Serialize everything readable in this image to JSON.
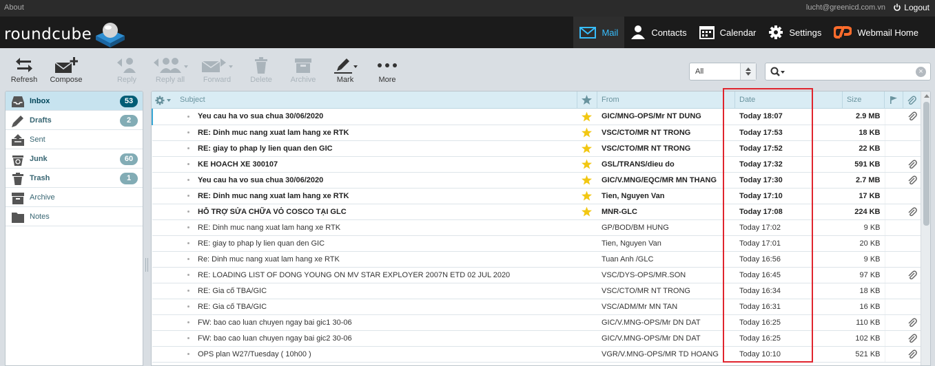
{
  "topbar": {
    "about": "About",
    "user_email": "lucht@greenicd.com.vn",
    "logout": "Logout"
  },
  "logo": {
    "text": "roundcube"
  },
  "nav": [
    {
      "label": "Mail",
      "icon": "mail-icon",
      "active": true
    },
    {
      "label": "Contacts",
      "icon": "contacts-icon"
    },
    {
      "label": "Calendar",
      "icon": "calendar-icon"
    },
    {
      "label": "Settings",
      "icon": "gear-icon"
    },
    {
      "label": "Webmail Home",
      "icon": "cpanel-icon"
    }
  ],
  "toolbar": {
    "refresh": "Refresh",
    "compose": "Compose",
    "reply": "Reply",
    "reply_all": "Reply all",
    "forward": "Forward",
    "delete": "Delete",
    "archive": "Archive",
    "mark": "Mark",
    "more": "More"
  },
  "filter": {
    "selected": "All"
  },
  "search": {
    "value": ""
  },
  "folders": [
    {
      "name": "Inbox",
      "count": "53",
      "selected": true,
      "bold": true
    },
    {
      "name": "Drafts",
      "count": "2",
      "bold": true
    },
    {
      "name": "Sent",
      "count": ""
    },
    {
      "name": "Junk",
      "count": "60",
      "bold": true
    },
    {
      "name": "Trash",
      "count": "1",
      "bold": true
    },
    {
      "name": "Archive",
      "count": ""
    },
    {
      "name": "Notes",
      "count": ""
    }
  ],
  "list_header": {
    "subject": "Subject",
    "from": "From",
    "date": "Date",
    "size": "Size"
  },
  "messages": [
    {
      "subject": "Yeu cau ha vo sua chua 30/06/2020",
      "from": "GIC/MNG-OPS/Mr NT DUNG",
      "date": "Today 18:07",
      "size": "2.9 MB",
      "unread": true,
      "flagged": true,
      "attachment": true
    },
    {
      "subject": "RE: Dinh muc nang xuat lam hang xe RTK",
      "from": "VSC/CTO/MR NT TRONG",
      "date": "Today 17:53",
      "size": "18 KB",
      "unread": true,
      "flagged": true,
      "attachment": false
    },
    {
      "subject": "RE: giay to phap ly lien quan den GIC",
      "from": "VSC/CTO/MR NT TRONG",
      "date": "Today 17:52",
      "size": "22 KB",
      "unread": true,
      "flagged": true,
      "attachment": false
    },
    {
      "subject": "KE HOACH XE 300107",
      "from": "GSL/TRANS/dieu do",
      "date": "Today 17:32",
      "size": "591 KB",
      "unread": true,
      "flagged": true,
      "attachment": true
    },
    {
      "subject": "Yeu cau ha vo sua chua 30/06/2020",
      "from": "GIC/V.MNG/EQC/MR MN THANG",
      "date": "Today 17:30",
      "size": "2.7 MB",
      "unread": true,
      "flagged": true,
      "attachment": true
    },
    {
      "subject": "RE: Dinh muc nang xuat lam hang xe RTK",
      "from": "Tien, Nguyen Van",
      "date": "Today 17:10",
      "size": "17 KB",
      "unread": true,
      "flagged": true,
      "attachment": false
    },
    {
      "subject": "HỖ TRỢ SỬA CHỮA VỎ COSCO TẠI GLC",
      "from": "MNR-GLC",
      "date": "Today 17:08",
      "size": "224 KB",
      "unread": true,
      "flagged": true,
      "attachment": true
    },
    {
      "subject": "RE: Dinh muc nang xuat lam hang xe RTK",
      "from": "GP/BOD/BM HUNG",
      "date": "Today 17:02",
      "size": "9 KB",
      "unread": false,
      "flagged": false,
      "attachment": false
    },
    {
      "subject": "RE: giay to phap ly lien quan den GIC",
      "from": "Tien, Nguyen Van",
      "date": "Today 17:01",
      "size": "20 KB",
      "unread": false,
      "flagged": false,
      "attachment": false
    },
    {
      "subject": "Re: Dinh muc nang xuat lam hang xe RTK",
      "from": "Tuan Anh /GLC",
      "date": "Today 16:56",
      "size": "9 KB",
      "unread": false,
      "flagged": false,
      "attachment": false
    },
    {
      "subject": "RE: LOADING LIST OF DONG YOUNG ON MV STAR EXPLOYER 2007N ETD 02 JUL 2020",
      "from": "VSC/DYS-OPS/MR.SON",
      "date": "Today 16:45",
      "size": "97 KB",
      "unread": false,
      "flagged": false,
      "attachment": true
    },
    {
      "subject": "RE: Gia cố TBA/GIC",
      "from": "VSC/CTO/MR NT TRONG",
      "date": "Today 16:34",
      "size": "18 KB",
      "unread": false,
      "flagged": false,
      "attachment": false
    },
    {
      "subject": "RE: Gia cố TBA/GIC",
      "from": "VSC/ADM/Mr MN TAN",
      "date": "Today 16:31",
      "size": "16 KB",
      "unread": false,
      "flagged": false,
      "attachment": false
    },
    {
      "subject": "FW: bao cao luan chuyen ngay bai gic1 30-06",
      "from": "GIC/V.MNG-OPS/Mr DN DAT",
      "date": "Today 16:25",
      "size": "110 KB",
      "unread": false,
      "flagged": false,
      "attachment": true
    },
    {
      "subject": "FW: bao cao luan chuyen ngay bai gic2 30-06",
      "from": "GIC/V.MNG-OPS/Mr DN DAT",
      "date": "Today 16:25",
      "size": "102 KB",
      "unread": false,
      "flagged": false,
      "attachment": true
    },
    {
      "subject": "OPS plan W27/Tuesday ( 10h00 )",
      "from": "VGR/V.MNG-OPS/MR TD HOANG",
      "date": "Today 10:10",
      "size": "521 KB",
      "unread": false,
      "flagged": false,
      "attachment": true
    }
  ],
  "colors": {
    "accent": "#37beff",
    "star": "#f2c712",
    "highlight_box": "#e0242d",
    "header_bg": "#1b1b1b"
  }
}
